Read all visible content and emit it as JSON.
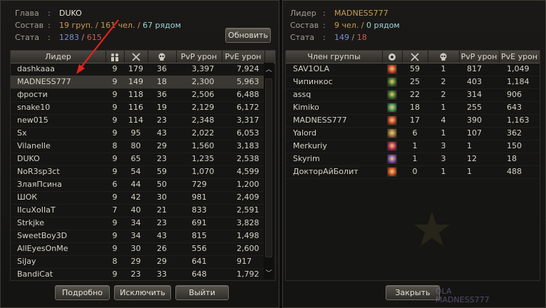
{
  "left": {
    "info": {
      "leader_label": "Глава",
      "leader_value": "DUKO",
      "comp_label": "Состав",
      "comp_groups": "19 груп.",
      "comp_people": "161 чел.",
      "comp_near": "67 рядом",
      "stat_label": "Стата",
      "stat_a": "1283",
      "stat_b": "615"
    },
    "refresh_label": "Обновить",
    "columns": [
      "Лидер",
      "",
      "",
      "",
      "PvP урон",
      "PvE урон"
    ],
    "rows": [
      {
        "name": "dashkaaa",
        "n": "9",
        "k": "179",
        "d": "36",
        "pvp": "3,397",
        "pve": "7,924"
      },
      {
        "name": "MADNESS777",
        "n": "9",
        "k": "149",
        "d": "18",
        "pvp": "2,300",
        "pve": "5,963"
      },
      {
        "name": "фрости",
        "n": "9",
        "k": "118",
        "d": "36",
        "pvp": "2,506",
        "pve": "6,488"
      },
      {
        "name": "snake10",
        "n": "9",
        "k": "116",
        "d": "19",
        "pvp": "2,129",
        "pve": "6,172"
      },
      {
        "name": "new015",
        "n": "9",
        "k": "114",
        "d": "23",
        "pvp": "2,348",
        "pve": "3,317"
      },
      {
        "name": "Sx",
        "n": "9",
        "k": "95",
        "d": "43",
        "pvp": "2,022",
        "pve": "6,053"
      },
      {
        "name": "Vilanelle",
        "n": "8",
        "k": "80",
        "d": "29",
        "pvp": "1,560",
        "pve": "3,183"
      },
      {
        "name": "DUKO",
        "n": "9",
        "k": "65",
        "d": "23",
        "pvp": "1,235",
        "pve": "2,538"
      },
      {
        "name": "NoR3sp3ct",
        "n": "9",
        "k": "54",
        "d": "59",
        "pvp": "1,070",
        "pve": "4,599"
      },
      {
        "name": "ЗлаяПсина",
        "n": "6",
        "k": "44",
        "d": "50",
        "pvp": "729",
        "pve": "1,200"
      },
      {
        "name": "ШОК",
        "n": "9",
        "k": "42",
        "d": "30",
        "pvp": "981",
        "pve": "2,409"
      },
      {
        "name": "IIcuXoIIaT",
        "n": "7",
        "k": "40",
        "d": "21",
        "pvp": "833",
        "pve": "2,591"
      },
      {
        "name": "Strkjke",
        "n": "9",
        "k": "34",
        "d": "23",
        "pvp": "691",
        "pve": "3,828"
      },
      {
        "name": "SweetBoy3D",
        "n": "9",
        "k": "34",
        "d": "43",
        "pvp": "815",
        "pve": "1,498"
      },
      {
        "name": "AllEyesOnMe",
        "n": "9",
        "k": "30",
        "d": "26",
        "pvp": "556",
        "pve": "2,600"
      },
      {
        "name": "SiJay",
        "n": "8",
        "k": "29",
        "d": "29",
        "pvp": "641",
        "pve": "917"
      },
      {
        "name": "BandiCat",
        "n": "9",
        "k": "23",
        "d": "33",
        "pvp": "648",
        "pve": "1,792"
      }
    ],
    "btn_details": "Подробно",
    "btn_exclude": "Исключить",
    "btn_leave": "Выйти"
  },
  "right": {
    "info": {
      "leader_label": "Лидер",
      "leader_value": "MADNESS777",
      "comp_label": "Состав",
      "comp_people": "9 чел.",
      "comp_near": "0 рядом",
      "stat_label": "Стата",
      "stat_a": "149",
      "stat_b": "18"
    },
    "columns": [
      "Член группы",
      "",
      "",
      "",
      "PvP урон",
      "PvE урон"
    ],
    "rows": [
      {
        "name": "SAV1OLA",
        "cls": "#b8422a",
        "k": "59",
        "d": "1",
        "pvp": "817",
        "pve": "1,049"
      },
      {
        "name": "Чипинкос",
        "cls": "#3d6b2e",
        "k": "25",
        "d": "2",
        "pvp": "403",
        "pve": "1,184"
      },
      {
        "name": "assq",
        "cls": "#3d6b2e",
        "k": "22",
        "d": "2",
        "pvp": "314",
        "pve": "906"
      },
      {
        "name": "Kimiko",
        "cls": "#3e8a5a",
        "k": "18",
        "d": "1",
        "pvp": "255",
        "pve": "643"
      },
      {
        "name": "MADNESS777",
        "cls": "#b8422a",
        "k": "17",
        "d": "4",
        "pvp": "390",
        "pve": "1,163"
      },
      {
        "name": "Yalord",
        "cls": "#8a6a3a",
        "k": "6",
        "d": "1",
        "pvp": "107",
        "pve": "362"
      },
      {
        "name": "Merkuriy",
        "cls": "#b02a5a",
        "k": "1",
        "d": "3",
        "pvp": "1",
        "pve": "150"
      },
      {
        "name": "Skyrim",
        "cls": "#7a4aa8",
        "k": "1",
        "d": "3",
        "pvp": "12",
        "pve": "18"
      },
      {
        "name": "ДокторАйБолит",
        "cls": "#c24a22",
        "k": "0",
        "d": "1",
        "pvp": "1",
        "pve": "488"
      }
    ],
    "btn_close": "Закрыть"
  },
  "watermark": {
    "line1": "OLA",
    "line2": "MADNESS777"
  }
}
